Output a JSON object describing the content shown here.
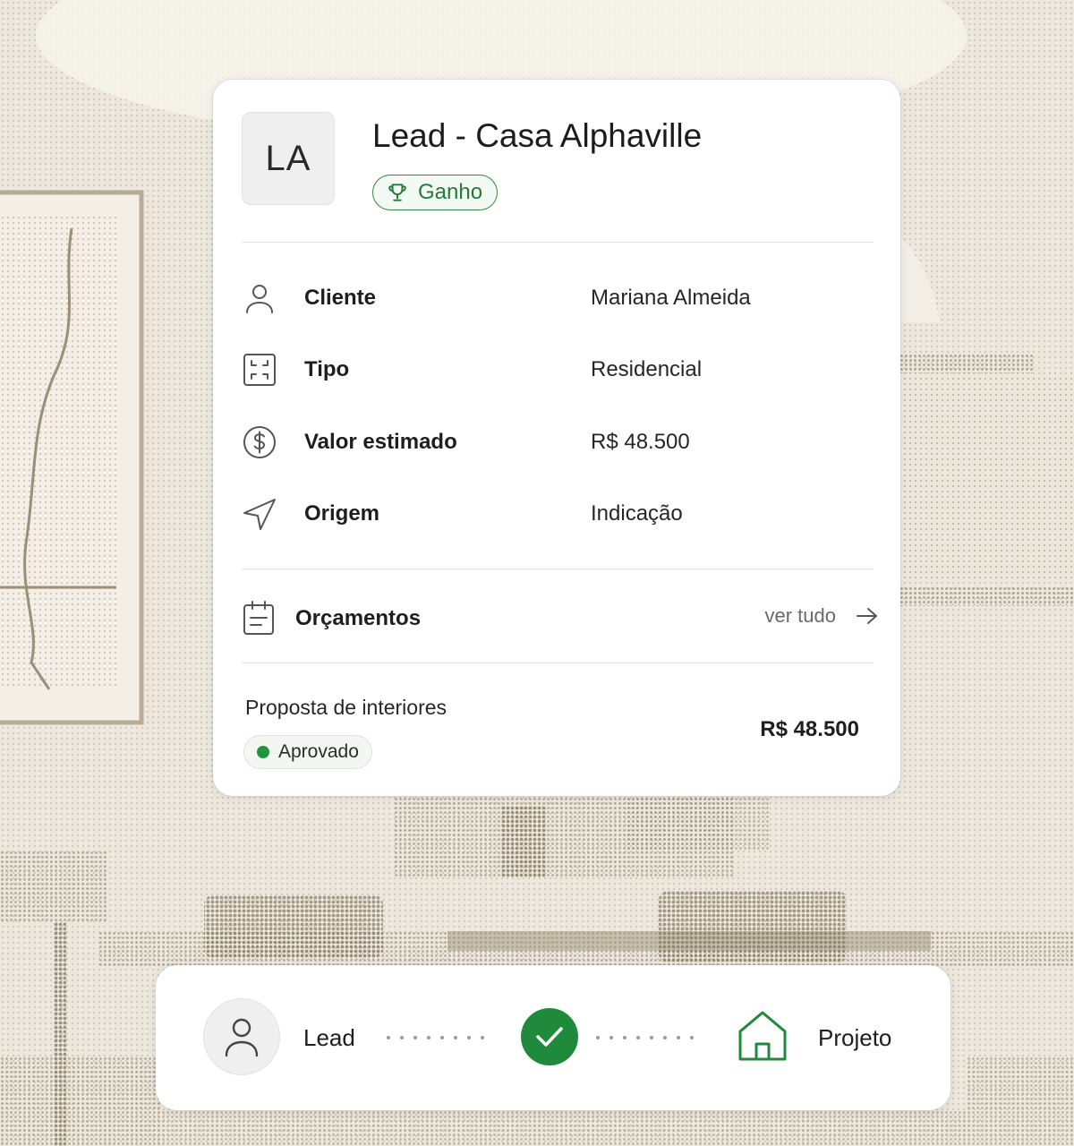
{
  "lead": {
    "initials": "LA",
    "title": "Lead - Casa Alphaville",
    "status": {
      "label": "Ganho",
      "icon": "trophy-icon",
      "color": "#2e8a44"
    },
    "fields": [
      {
        "icon": "user-icon",
        "label": "Cliente",
        "value": "Mariana Almeida"
      },
      {
        "icon": "building-type-icon",
        "label": "Tipo",
        "value": "Residencial"
      },
      {
        "icon": "dollar-circle-icon",
        "label": "Valor estimado",
        "value": "R$ 48.500"
      },
      {
        "icon": "send-arrow-icon",
        "label": "Origem",
        "value": "Indicação"
      }
    ]
  },
  "quotes": {
    "icon": "clipboard-icon",
    "title": "Orçamentos",
    "see_all": "ver tudo",
    "see_all_icon": "arrow-right-icon",
    "items": [
      {
        "name": "Proposta de interiores",
        "status": "Aprovado",
        "status_color": "#24933f",
        "amount": "R$ 48.500"
      }
    ]
  },
  "flow": {
    "from_label": "Lead",
    "from_icon": "user-icon",
    "transition_icon": "check-icon",
    "transition_color": "#1f8a3b",
    "to_label": "Projeto",
    "to_icon": "house-icon"
  }
}
